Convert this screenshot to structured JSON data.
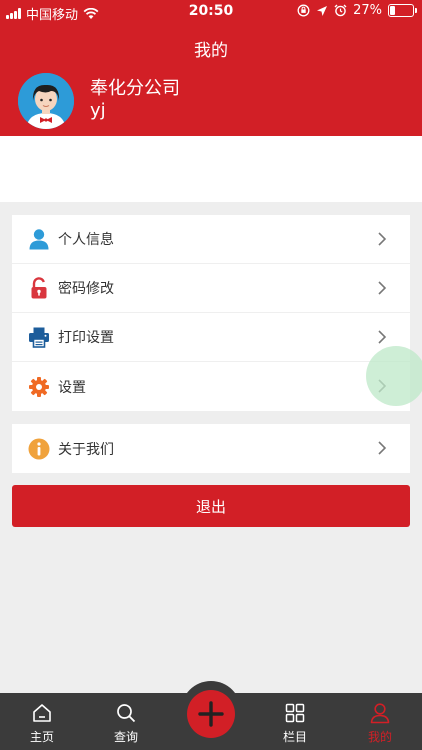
{
  "status_bar": {
    "carrier": "中国移动",
    "time": "20:50",
    "battery": "27%",
    "battery_level": 0.27
  },
  "header": {
    "title": "我的",
    "company": "奉化分公司",
    "username": "yj"
  },
  "menu": {
    "items": [
      {
        "label": "个人信息",
        "icon": "person-icon",
        "color": "#2d9bd8"
      },
      {
        "label": "密码修改",
        "icon": "lock-icon",
        "color": "#d9363e"
      },
      {
        "label": "打印设置",
        "icon": "printer-icon",
        "color": "#1d5d9b"
      },
      {
        "label": "设置",
        "icon": "gear-icon",
        "color": "#f06a24"
      }
    ],
    "about": {
      "label": "关于我们",
      "icon": "info-icon",
      "color": "#f0a23c"
    }
  },
  "logout_label": "退出",
  "tabbar": {
    "tabs": [
      {
        "label": "主页",
        "icon": "home-icon"
      },
      {
        "label": "查询",
        "icon": "search-icon"
      },
      {
        "label": "栏目",
        "icon": "grid-icon"
      },
      {
        "label": "我的",
        "icon": "user-icon",
        "active": true
      }
    ],
    "center_icon": "plus-icon"
  },
  "colors": {
    "brand": "#d21f26",
    "tabbar": "#3b3b3b",
    "background": "#eeeeee"
  }
}
